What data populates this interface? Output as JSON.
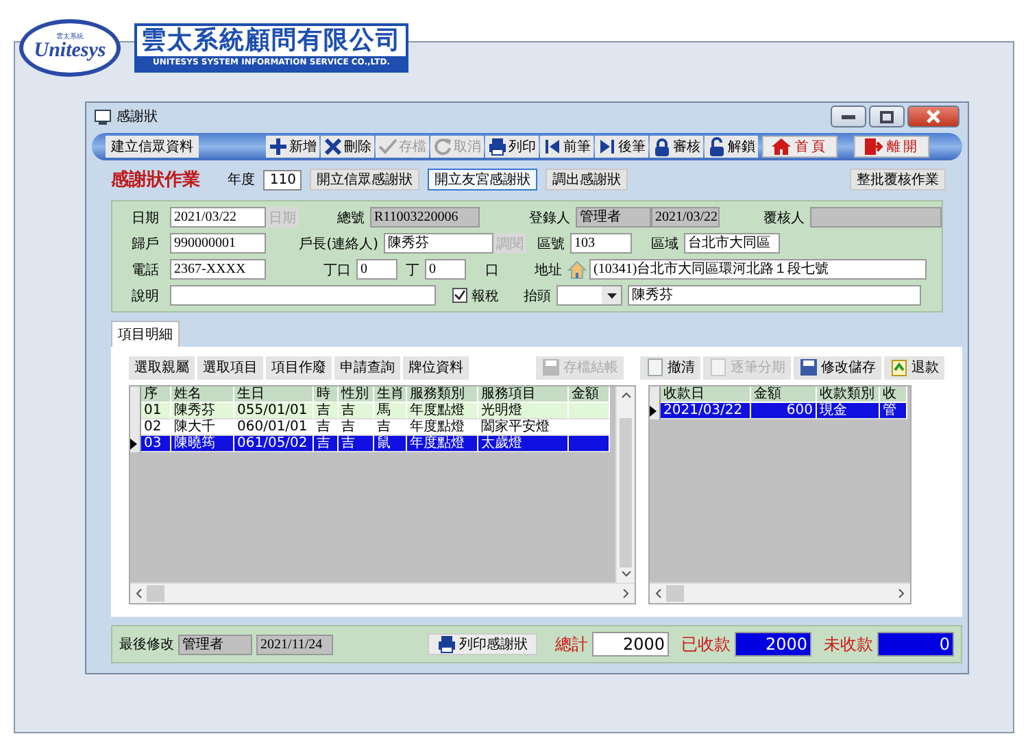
{
  "company": {
    "logo_text": "Unitesys",
    "logo_small": "雲太系統",
    "name": "雲太系統顧問有限公司",
    "subtitle": "UNITESYS SYSTEM INFORMATION SERVICE CO.,LTD."
  },
  "window": {
    "title": "感謝狀"
  },
  "toolbar": {
    "left_button": "建立信眾資料",
    "actions": [
      {
        "label": "新增",
        "disabled": false
      },
      {
        "label": "刪除",
        "disabled": false
      },
      {
        "label": "存檔",
        "disabled": true
      },
      {
        "label": "取消",
        "disabled": true
      },
      {
        "label": "列印",
        "disabled": false
      },
      {
        "label": "前筆",
        "disabled": false
      },
      {
        "label": "後筆",
        "disabled": false
      },
      {
        "label": "審核",
        "disabled": false
      },
      {
        "label": "解鎖",
        "disabled": false
      }
    ],
    "nav": [
      "首頁",
      "離開"
    ]
  },
  "header": {
    "title": "感謝狀作業",
    "year_label": "年度",
    "year": "110",
    "buttons": [
      {
        "label": "開立信眾感謝狀",
        "selected": false
      },
      {
        "label": "開立友宮感謝狀",
        "selected": true
      },
      {
        "label": "調出感謝狀",
        "selected": false
      }
    ],
    "batch_button": "整批覆核作業"
  },
  "form": {
    "date": {
      "label": "日期",
      "value": "2021/03/22",
      "button": "日期"
    },
    "serial": {
      "label": "總號",
      "value": "R11003220006"
    },
    "registrar": {
      "label": "登錄人",
      "name": "管理者",
      "date": "2021/03/22"
    },
    "reviewer": {
      "label": "覆核人"
    },
    "household": {
      "label": "歸戶",
      "value": "990000001"
    },
    "head": {
      "label": "戶長(連絡人)",
      "value": "陳秀芬",
      "button": "調閱"
    },
    "zip": {
      "label": "區號",
      "value": "103"
    },
    "district": {
      "label": "區域",
      "value": "台北市大同區"
    },
    "phone": {
      "label": "電話",
      "value": "2367-XXXX"
    },
    "headcount": {
      "label": "丁口",
      "male": "0",
      "male_unit": "丁",
      "female": "0",
      "female_unit": "口"
    },
    "address": {
      "label": "地址",
      "value": "(10341)台北市大同區環河北路１段七號"
    },
    "note": {
      "label": "說明"
    },
    "tax": {
      "label": "報稅",
      "checked": true
    },
    "title": {
      "label": "抬頭",
      "value": "陳秀芬"
    }
  },
  "tabs": [
    {
      "label": "項目明細",
      "selected": true
    }
  ],
  "detail_buttons": [
    "選取親屬",
    "選取項目",
    "項目作廢",
    "申請查詢",
    "牌位資料"
  ],
  "payment_buttons": [
    {
      "label": "存檔結帳",
      "disabled": true
    },
    {
      "label": "撤清",
      "disabled": false
    },
    {
      "label": "逐筆分期",
      "disabled": true
    },
    {
      "label": "修改儲存",
      "disabled": false
    },
    {
      "label": "退款",
      "disabled": false
    }
  ],
  "items_table": {
    "columns": [
      "序",
      "姓名",
      "生日",
      "時",
      "性別",
      "生肖",
      "服務類別",
      "服務項目",
      "金額"
    ],
    "rows": [
      {
        "cells": [
          "01",
          "陳秀芬",
          "055/01/01",
          "吉",
          "吉",
          "馬",
          "年度點燈",
          "光明燈"
        ],
        "selected": false
      },
      {
        "cells": [
          "02",
          "陳大千",
          "060/01/01",
          "吉",
          "吉",
          "吉",
          "年度點燈",
          "闔家平安燈"
        ],
        "selected": false
      },
      {
        "cells": [
          "03",
          "陳曉筠",
          "061/05/02",
          "吉",
          "吉",
          "鼠",
          "年度點燈",
          "太歲燈"
        ],
        "selected": true
      }
    ]
  },
  "payments_table": {
    "columns": [
      "收款日",
      "金額",
      "收款類別",
      "收"
    ],
    "rows": [
      {
        "cells": [
          "2021/03/22",
          "600",
          "現金",
          "管"
        ],
        "selected": true
      }
    ]
  },
  "footer": {
    "last_modified_label": "最後修改",
    "modified_by": "管理者",
    "modified_date": "2021/11/24",
    "print_button": "列印感謝狀",
    "totals": [
      {
        "label": "總計",
        "value": "2000",
        "kind": "input"
      },
      {
        "label": "已收款",
        "value": "2000",
        "kind": "display"
      },
      {
        "label": "未收款",
        "value": "0",
        "kind": "display"
      }
    ]
  }
}
